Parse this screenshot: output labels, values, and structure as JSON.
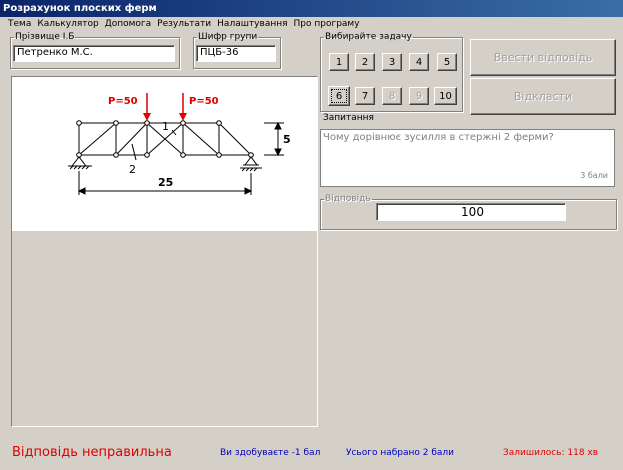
{
  "window": {
    "title": "Розрахунок плоских ферм"
  },
  "menu": [
    "Тема",
    "Калькулятор",
    "Допомога",
    "Результати",
    "Налаштування",
    "Про програму"
  ],
  "student": {
    "surname_label": "Прізвище І.Б",
    "surname_value": "Петренко М.С.",
    "group_label": "Шифр групи",
    "group_value": "ПЦБ-36"
  },
  "tasks": {
    "label": "Вибирайте задачу",
    "buttons": [
      "1",
      "2",
      "3",
      "4",
      "5",
      "6",
      "7",
      "8",
      "9",
      "10"
    ],
    "selected": "6",
    "disabled": [
      "8",
      "9"
    ]
  },
  "actions": {
    "enter_answer": "Ввести відповідь",
    "postpone": "Відкласти"
  },
  "question": {
    "label": "Запитання",
    "text": "Чому дорівнює зусилля в стержні 2 ферми?",
    "points": "3 бали"
  },
  "answer": {
    "label": "Відповідь",
    "value": "100"
  },
  "truss": {
    "load_left": "P=50",
    "load_right": "P=50",
    "height": "5",
    "span": "25",
    "member_1": "1",
    "member_2": "2",
    "load_color": "#e00000"
  },
  "statusbar": {
    "result": "Відповідь неправильна",
    "gain": "Ви здобуваєте -1 бал",
    "total": "Усього набрано 2 бали",
    "remaining": "Залишилось: 118 хв",
    "result_color": "#e00000",
    "info_color": "#0000c0"
  }
}
